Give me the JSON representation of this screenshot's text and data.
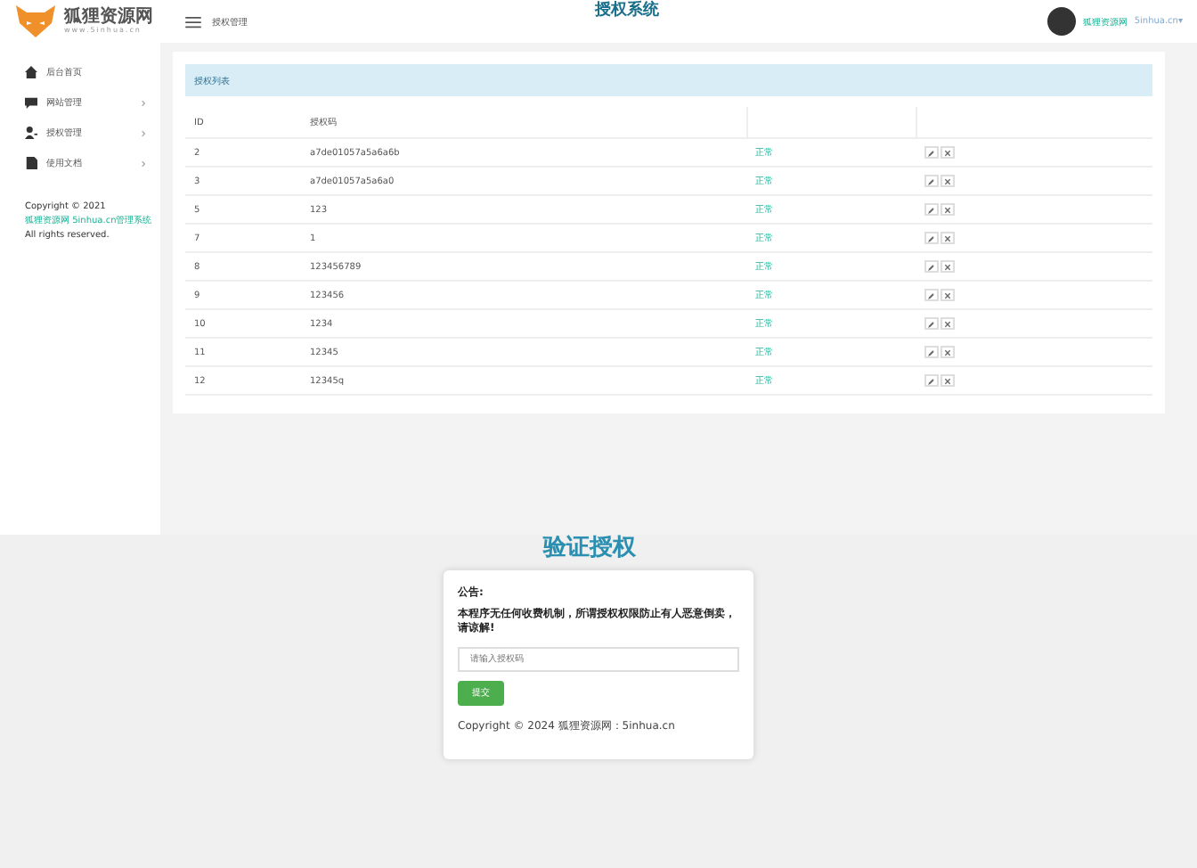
{
  "brand": {
    "name": "狐狸资源网",
    "url": "www.5inhua.cn"
  },
  "header": {
    "title": "授权管理",
    "logo_text": "授权系统",
    "user_name": "狐狸资源网",
    "user_account": "5inhua.cn▾"
  },
  "sidebar": {
    "items": [
      {
        "label": "后台首页",
        "has_children": false
      },
      {
        "label": "网站管理",
        "has_children": true
      },
      {
        "label": "授权管理",
        "has_children": true
      },
      {
        "label": "使用文档",
        "has_children": true
      }
    ],
    "copyright": {
      "prefix": "Copyright © 2021 ",
      "link": "狐狸资源网 5inhua.cn管理系统",
      "suffix": " All rights reserved."
    }
  },
  "panel": {
    "heading": "授权列表",
    "columns": [
      "ID",
      "授权码"
    ],
    "rows": [
      {
        "id": "2",
        "code": "a7de01057a5a6a6b",
        "status": "正常"
      },
      {
        "id": "3",
        "code": "a7de01057a5a6a0",
        "status": "正常"
      },
      {
        "id": "5",
        "code": "123",
        "status": "正常"
      },
      {
        "id": "7",
        "code": "1",
        "status": "正常"
      },
      {
        "id": "8",
        "code": "123456789",
        "status": "正常"
      },
      {
        "id": "9",
        "code": "123456",
        "status": "正常"
      },
      {
        "id": "10",
        "code": "1234",
        "status": "正常"
      },
      {
        "id": "11",
        "code": "12345",
        "status": "正常"
      },
      {
        "id": "12",
        "code": "12345q",
        "status": "正常"
      }
    ]
  },
  "verify": {
    "logo_text": "验证授权",
    "notice_title": "公告:",
    "notice": "本程序无任何收费机制，所谓授权权限防止有人恶意倒卖，请谅解!",
    "placeholder": "请输入授权码",
    "button": "提交",
    "copyright": "Copyright © 2024 狐狸资源网：5inhua.cn"
  }
}
